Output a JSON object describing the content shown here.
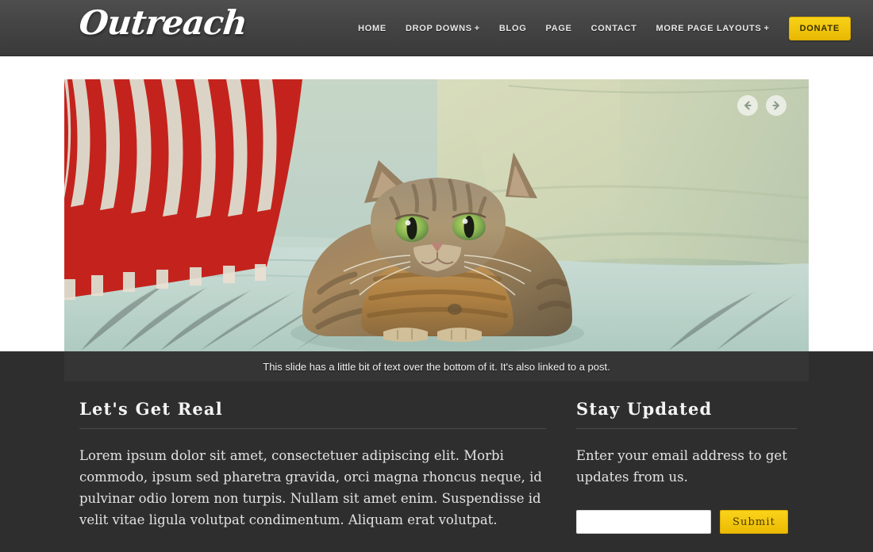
{
  "site": {
    "logo_text": "Outreach"
  },
  "nav": {
    "items": [
      {
        "label": "HOME",
        "caret": ""
      },
      {
        "label": "DROP DOWNS",
        "caret": "+"
      },
      {
        "label": "BLOG",
        "caret": ""
      },
      {
        "label": "PAGE",
        "caret": ""
      },
      {
        "label": "CONTACT",
        "caret": ""
      },
      {
        "label": "MORE PAGE LAYOUTS",
        "caret": "+"
      }
    ],
    "donate_label": "DONATE",
    "donate_color": "#f0c40c"
  },
  "slider": {
    "prev_icon": "arrow-left-icon",
    "next_icon": "arrow-right-icon",
    "caption": "This slide has a little bit of text over the bottom of it. It's also linked to a post.",
    "photo_description": "Tabby cat sitting on a pale mint couch with a red and white striped pillow on the left and an olive green cushion on the right"
  },
  "left_column": {
    "heading": "Let's Get Real",
    "body": "Lorem ipsum dolor sit amet, consectetuer adipiscing elit. Morbi commodo, ipsum sed pharetra gravida, orci magna rhoncus neque, id pulvinar odio lorem non turpis. Nullam sit amet enim. Suspendisse id velit vitae ligula volutpat condimentum. Aliquam erat volutpat."
  },
  "right_column": {
    "heading": "Stay Updated",
    "body": "Enter your email address to get updates from us.",
    "email_value": "",
    "email_placeholder": "",
    "submit_label": "Submit"
  },
  "theme": {
    "header_bg": "#444444",
    "section_bg": "#2e2e2e",
    "accent_yellow": "#f0c40c",
    "text_light": "#e3e3e3"
  }
}
